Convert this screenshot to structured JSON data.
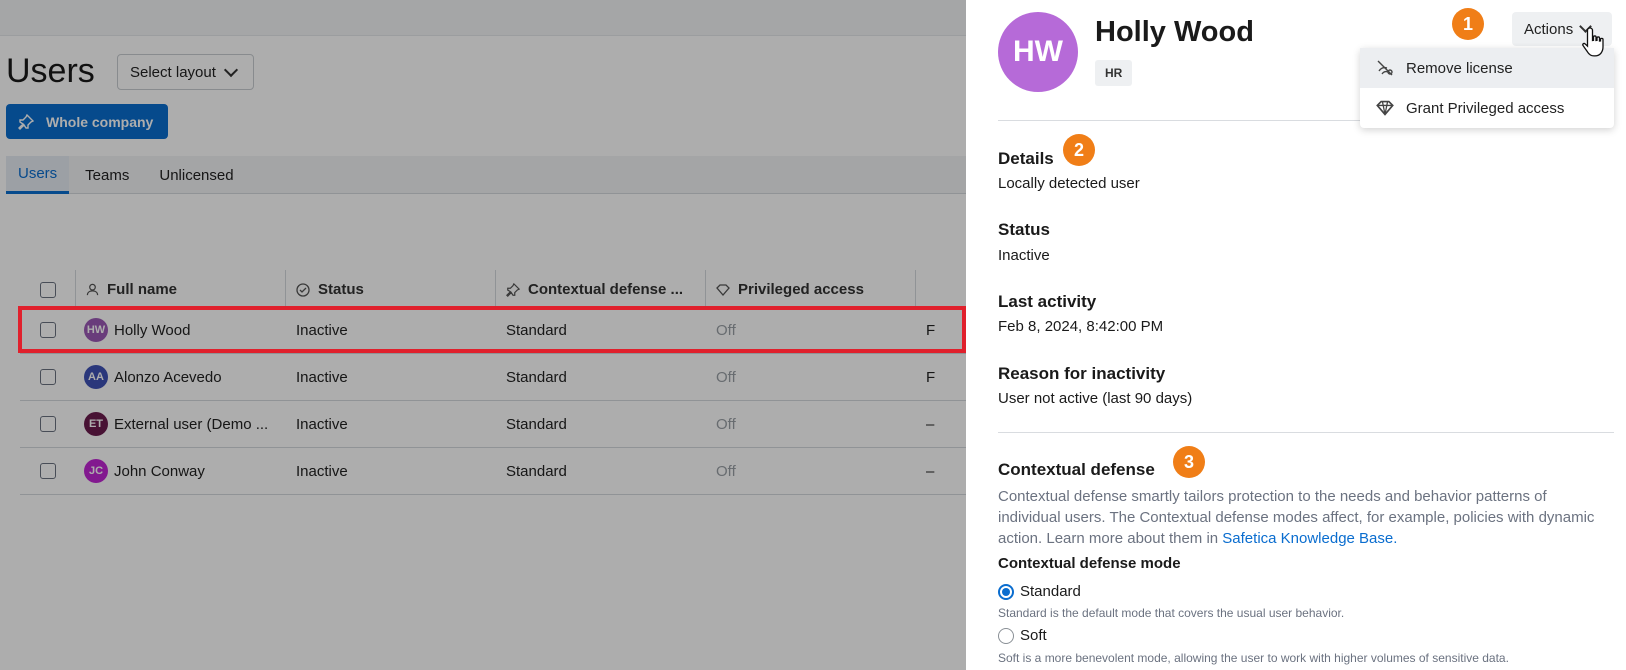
{
  "page": {
    "title": "Users",
    "layout_select": "Select layout",
    "scope_button": "Whole company"
  },
  "tabs": [
    "Users",
    "Teams",
    "Unlicensed"
  ],
  "table": {
    "columns": [
      "Full name",
      "Status",
      "Contextual defense ...",
      "Privileged access"
    ],
    "rows": [
      {
        "initials": "HW",
        "avatar_color": "#9b59b6",
        "name": "Holly Wood",
        "status": "Inactive",
        "mode": "Standard",
        "privileged": "Off",
        "extra": "F"
      },
      {
        "initials": "AA",
        "avatar_color": "#3f51b5",
        "name": "Alonzo Acevedo",
        "status": "Inactive",
        "mode": "Standard",
        "privileged": "Off",
        "extra": "F"
      },
      {
        "initials": "ET",
        "avatar_color": "#6a1b4d",
        "name": "External user (Demo ...",
        "status": "Inactive",
        "mode": "Standard",
        "privileged": "Off",
        "extra": "–"
      },
      {
        "initials": "JC",
        "avatar_color": "#c026d3",
        "name": "John Conway",
        "status": "Inactive",
        "mode": "Standard",
        "privileged": "Off",
        "extra": "–"
      }
    ]
  },
  "panel": {
    "initials": "HW",
    "name": "Holly Wood",
    "tag": "HR",
    "actions_label": "Actions",
    "menu": [
      "Remove license",
      "Grant Privileged access"
    ],
    "badges": [
      "1",
      "2",
      "3"
    ],
    "details_title": "Details",
    "details_value": "Locally detected user",
    "status_title": "Status",
    "status_value": "Inactive",
    "last_activity_title": "Last activity",
    "last_activity_value": "Feb 8, 2024, 8:42:00 PM",
    "reason_title": "Reason for inactivity",
    "reason_value": "User not active (last 90 days)",
    "cd_title": "Contextual defense",
    "cd_desc": "Contextual defense smartly tailors protection to the needs and behavior patterns of individual users. The Contextual defense modes affect, for example, policies with dynamic action. Learn more about them in ",
    "cd_link": "Safetica Knowledge Base.",
    "mode_label": "Contextual defense mode",
    "mode_standard": "Standard",
    "mode_standard_help": "Standard is the default mode that covers the usual user behavior.",
    "mode_soft": "Soft",
    "mode_soft_help": "Soft is a more benevolent mode, allowing the user to work with higher volumes of sensitive data."
  },
  "colors": {
    "accent": "#0a6dcf",
    "badge": "#f07e17",
    "highlight": "#e0202c",
    "avatar_big": "#b66ad8"
  }
}
